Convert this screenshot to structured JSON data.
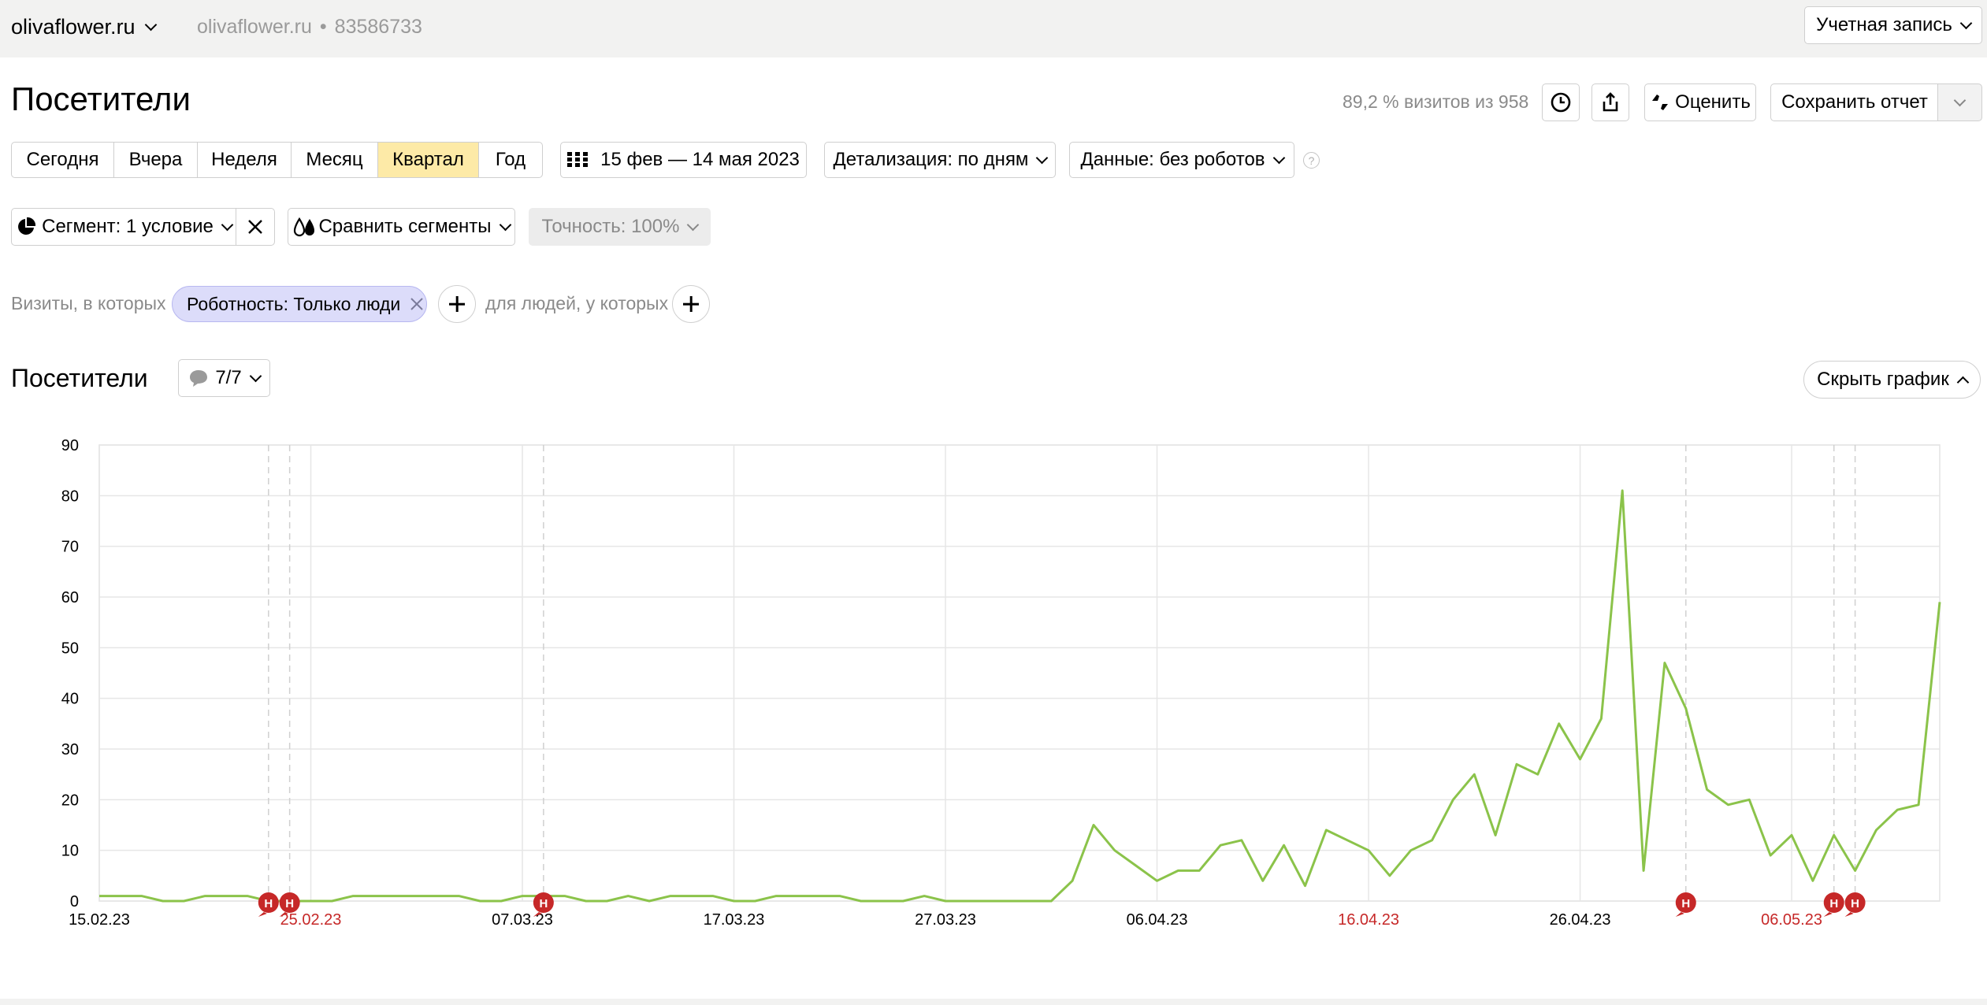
{
  "header": {
    "site_name": "olivaflower.ru",
    "site_sub": "olivaflower.ru",
    "counter_id": "83586733",
    "account_label": "Учетная запись"
  },
  "page": {
    "title": "Посетители",
    "visits_info": "89,2 % визитов из 958",
    "rate_label": "Оценить",
    "save_report_label": "Сохранить отчет"
  },
  "period_tabs": [
    "Сегодня",
    "Вчера",
    "Неделя",
    "Месяц",
    "Квартал",
    "Год"
  ],
  "active_period": "Квартал",
  "date_range": "15 фев — 14 мая 2023",
  "detail_label": "Детализация: по дням",
  "data_label": "Данные: без роботов",
  "segment": {
    "label": "Сегмент: 1 условие",
    "compare_label": "Сравнить сегменты",
    "accuracy_label": "Точность: 100%"
  },
  "filters": {
    "visits_prefix": "Визиты, в которых",
    "chip_label": "Роботность: Только люди",
    "people_prefix": "для людей, у которых"
  },
  "chart_section": {
    "title": "Посетители",
    "notes_count": "7/7",
    "hide_label": "Скрыть график"
  },
  "colors": {
    "line": "#8bc34a",
    "accent_tab": "#fdeaa7",
    "chip_bg": "#dcdcfa",
    "note_marker": "#c62828",
    "holiday_label": "#c62828"
  },
  "chart_data": {
    "type": "line",
    "ylim": [
      0,
      90
    ],
    "y_ticks": [
      "0",
      "10",
      "20",
      "30",
      "40",
      "50",
      "60",
      "70",
      "80",
      "90"
    ],
    "x_tick_labels": [
      {
        "label": "15.02.23",
        "holiday": false
      },
      {
        "label": "25.02.23",
        "holiday": true
      },
      {
        "label": "07.03.23",
        "holiday": false
      },
      {
        "label": "17.03.23",
        "holiday": false
      },
      {
        "label": "27.03.23",
        "holiday": false
      },
      {
        "label": "06.04.23",
        "holiday": false
      },
      {
        "label": "16.04.23",
        "holiday": true
      },
      {
        "label": "26.04.23",
        "holiday": false
      },
      {
        "label": "06.05.23",
        "holiday": true
      }
    ],
    "start_date": "2023-02-15",
    "x": [
      "15.02",
      "16.02",
      "17.02",
      "18.02",
      "19.02",
      "20.02",
      "21.02",
      "22.02",
      "23.02",
      "24.02",
      "25.02",
      "26.02",
      "27.02",
      "28.02",
      "01.03",
      "02.03",
      "03.03",
      "04.03",
      "05.03",
      "06.03",
      "07.03",
      "08.03",
      "09.03",
      "10.03",
      "11.03",
      "12.03",
      "13.03",
      "14.03",
      "15.03",
      "16.03",
      "17.03",
      "18.03",
      "19.03",
      "20.03",
      "21.03",
      "22.03",
      "23.03",
      "24.03",
      "25.03",
      "26.03",
      "27.03",
      "28.03",
      "29.03",
      "30.03",
      "31.03",
      "01.04",
      "02.04",
      "03.04",
      "04.04",
      "05.04",
      "06.04",
      "07.04",
      "08.04",
      "09.04",
      "10.04",
      "11.04",
      "12.04",
      "13.04",
      "14.04",
      "15.04",
      "16.04",
      "17.04",
      "18.04",
      "19.04",
      "20.04",
      "21.04",
      "22.04",
      "23.04",
      "24.04",
      "25.04",
      "26.04",
      "27.04",
      "28.04",
      "29.04",
      "30.04",
      "01.05",
      "02.05",
      "03.05",
      "04.05",
      "05.05",
      "06.05",
      "07.05",
      "08.05",
      "09.05",
      "10.05",
      "11.05",
      "12.05",
      "13.05",
      "14.05"
    ],
    "series": [
      {
        "values": [
          1,
          1,
          1,
          0,
          0,
          1,
          1,
          1,
          0,
          0,
          0,
          0,
          1,
          1,
          1,
          1,
          1,
          1,
          0,
          0,
          1,
          1,
          1,
          0,
          0,
          1,
          0,
          1,
          1,
          1,
          0,
          0,
          1,
          1,
          1,
          1,
          0,
          0,
          0,
          1,
          0,
          0,
          0,
          0,
          0,
          0,
          4,
          15,
          10,
          7,
          4,
          6,
          6,
          11,
          12,
          4,
          11,
          3,
          14,
          12,
          10,
          5,
          10,
          12,
          20,
          25,
          13,
          27,
          25,
          35,
          28,
          36,
          81,
          6,
          47,
          38,
          22,
          19,
          20,
          9,
          13,
          4,
          13,
          6,
          14,
          18,
          19,
          59
        ]
      }
    ],
    "notes_on_dates": [
      "23.02",
      "24.02",
      "08.03",
      "01.05",
      "08.05",
      "09.05"
    ]
  }
}
